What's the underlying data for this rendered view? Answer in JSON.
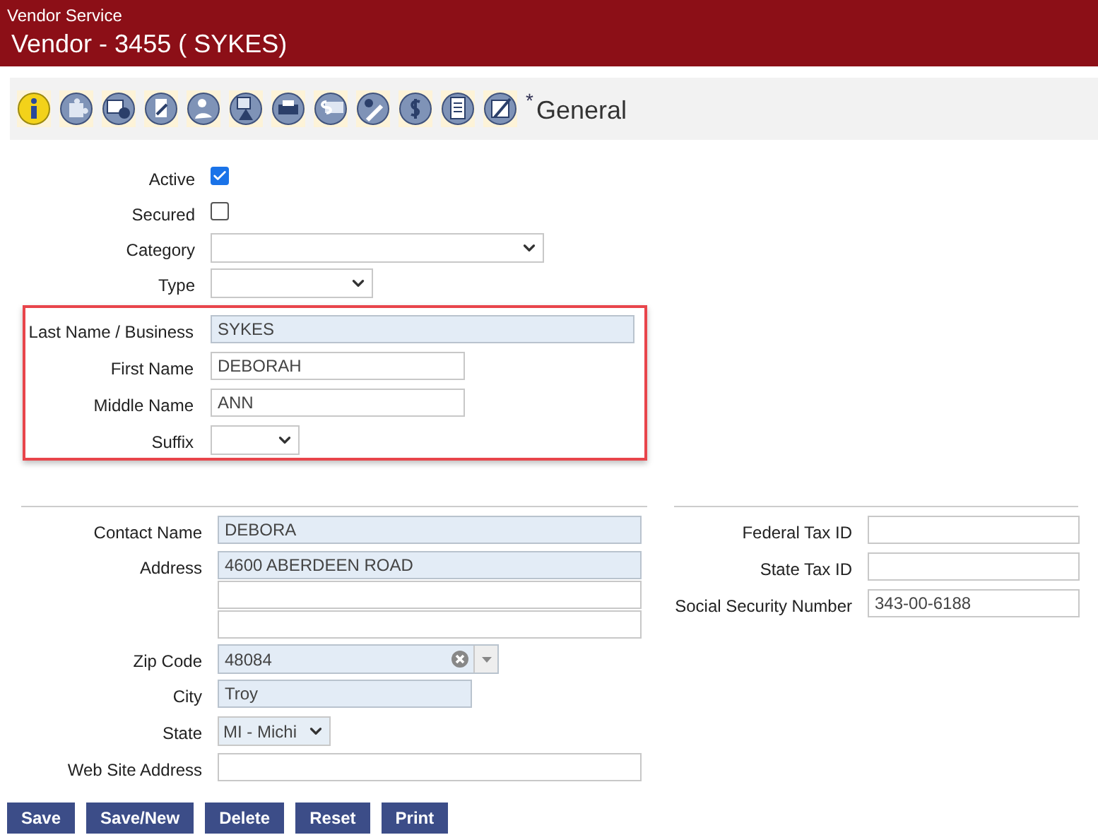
{
  "header": {
    "app_title": "Vendor Service",
    "title": "Vendor - 3455 ( SYKES)"
  },
  "toolbar": {
    "modified_mark": "*",
    "section_title": "General"
  },
  "general_fields": [
    {
      "kind": "checkbox",
      "label": "Active",
      "checked": true
    },
    {
      "kind": "checkbox",
      "label": "Secured",
      "checked": false
    },
    {
      "kind": "select",
      "label": "Category"
    },
    {
      "kind": "select",
      "label": "Type"
    }
  ],
  "name_fields": [
    {
      "kind": "text",
      "label": "Last Name / Business",
      "value": "SYKES",
      "required": true
    },
    {
      "kind": "text",
      "label": "First Name",
      "value": "DEBORAH",
      "required": false
    },
    {
      "kind": "text",
      "label": "Middle Name",
      "value": "ANN",
      "required": false
    },
    {
      "kind": "select",
      "label": "Suffix"
    }
  ],
  "address_fields": [
    {
      "kind": "text",
      "label": "Contact Name",
      "value": "DEBORA",
      "required": true
    },
    {
      "kind": "multiline",
      "label": "Address",
      "lines": [
        {
          "value": "4600 ABERDEEN ROAD",
          "required": true
        },
        {
          "required": false
        },
        {
          "required": false
        }
      ]
    },
    {
      "kind": "combo",
      "label": "Zip Code",
      "value": "48084",
      "required": true
    },
    {
      "kind": "text",
      "label": "City",
      "value": "Troy",
      "required": true
    },
    {
      "kind": "select",
      "label": "State",
      "value": "MI - Michi"
    },
    {
      "kind": "text",
      "label": "Web Site Address",
      "required": false
    }
  ],
  "tax_fields": [
    {
      "kind": "text",
      "label": "Federal Tax ID",
      "required": false
    },
    {
      "kind": "text",
      "label": "State Tax ID",
      "required": false
    },
    {
      "kind": "text",
      "label": "Social Security Number",
      "value": "343-00-6188",
      "required": false
    }
  ],
  "buttons": [
    "Save",
    "Save/New",
    "Delete",
    "Reset",
    "Print"
  ]
}
